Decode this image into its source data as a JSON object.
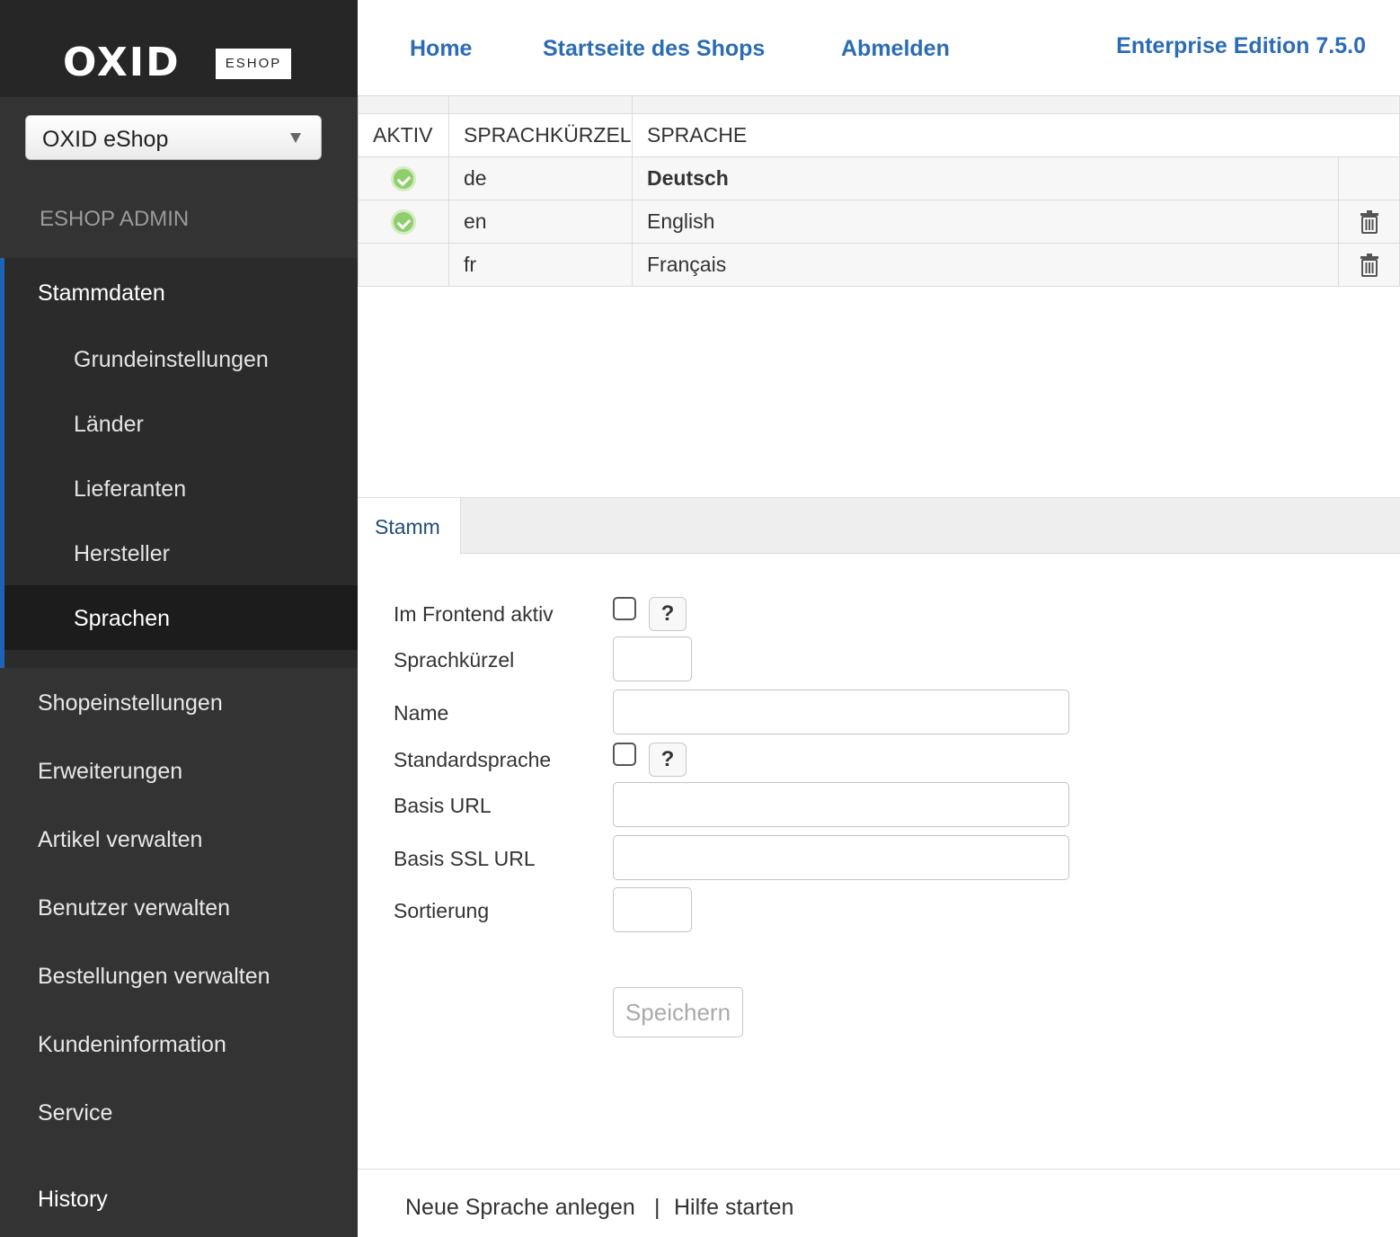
{
  "brand": {
    "logo_word": "OXID",
    "logo_sub": "ESHOP"
  },
  "shop_select": {
    "value": "OXID eShop"
  },
  "sidebar": {
    "section_title": "ESHOP ADMIN",
    "group": {
      "label": "Stammdaten",
      "items": [
        "Grundeinstellungen",
        "Länder",
        "Lieferanten",
        "Hersteller",
        "Sprachen"
      ],
      "active": "Sprachen"
    },
    "menu": [
      "Shopeinstellungen",
      "Erweiterungen",
      "Artikel verwalten",
      "Benutzer verwalten",
      "Bestellungen verwalten",
      "Kundeninformation",
      "Service",
      "History"
    ]
  },
  "header": {
    "links": [
      "Home",
      "Startseite des Shops",
      "Abmelden"
    ],
    "edition": "Enterprise Edition 7.5.0"
  },
  "table": {
    "columns": [
      "AKTIV",
      "SPRACHKÜRZEL",
      "SPRACHE"
    ],
    "rows": [
      {
        "active": true,
        "code": "de",
        "name": "Deutsch",
        "is_default": true,
        "deletable": false
      },
      {
        "active": true,
        "code": "en",
        "name": "English",
        "is_default": false,
        "deletable": true
      },
      {
        "active": false,
        "code": "fr",
        "name": "Français",
        "is_default": false,
        "deletable": true
      }
    ]
  },
  "tabs": [
    {
      "label": "Stamm",
      "selected": true
    }
  ],
  "form": {
    "frontend_active_label": "Im Frontend aktiv",
    "code_label": "Sprachkürzel",
    "name_label": "Name",
    "default_label": "Standardsprache",
    "base_url_label": "Basis URL",
    "base_ssl_url_label": "Basis SSL URL",
    "sort_label": "Sortierung",
    "help_glyph": "?",
    "save_label": "Speichern",
    "values": {
      "code": "",
      "name": "",
      "base_url": "",
      "base_ssl_url": "",
      "sort": ""
    }
  },
  "footer": {
    "new_language": "Neue Sprache anlegen",
    "separator": "|",
    "help": "Hilfe starten"
  },
  "colors": {
    "accent": "#2b6cb5",
    "sidebar_bg": "#333333",
    "active_marker": "#1f63b8",
    "status_green": "#8fcf6b"
  }
}
